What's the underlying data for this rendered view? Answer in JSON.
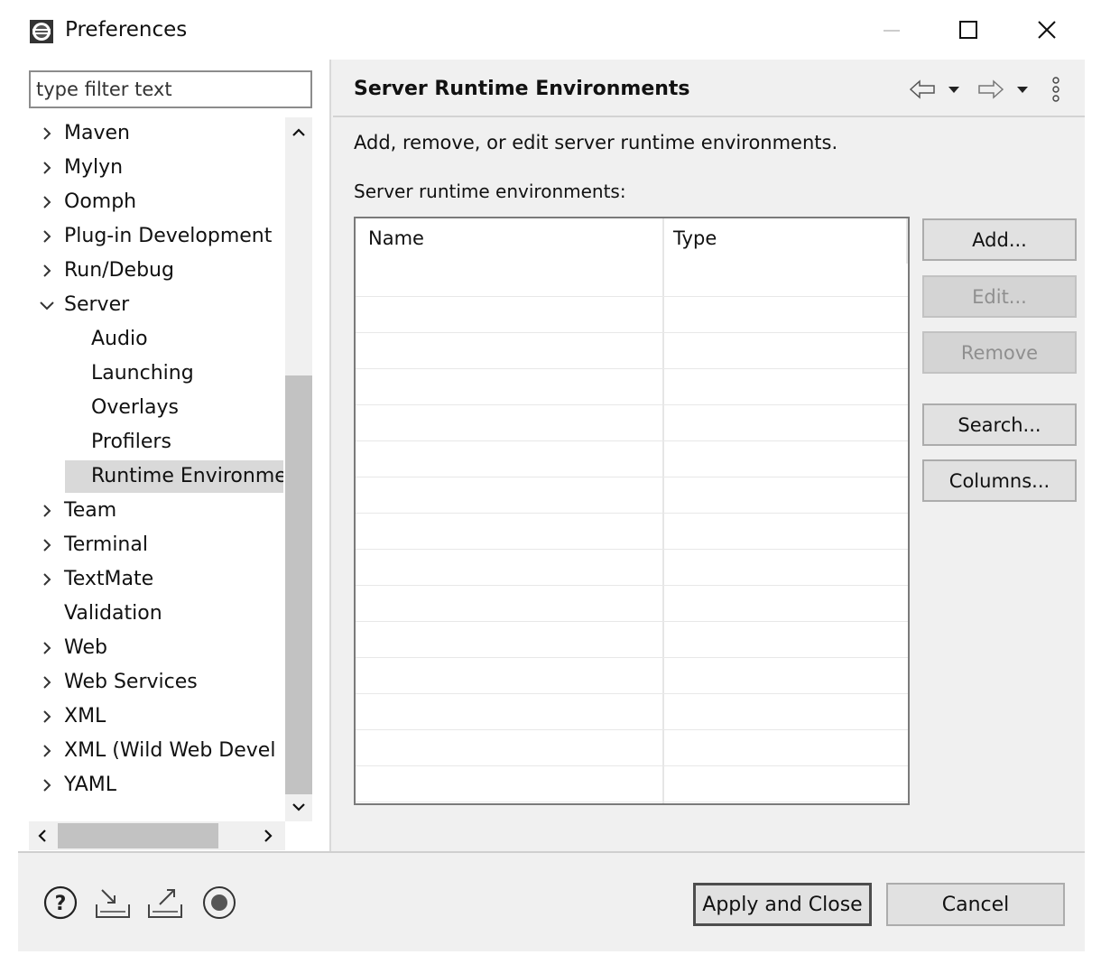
{
  "window": {
    "title": "Preferences",
    "controls": {
      "minimize": "minimize-icon",
      "maximize": "maximize-icon",
      "close": "close-icon"
    }
  },
  "filter": {
    "placeholder": "type filter text",
    "value": ""
  },
  "tree": {
    "items": [
      {
        "label": "Maven",
        "level": 0,
        "expander": "collapsed"
      },
      {
        "label": "Mylyn",
        "level": 0,
        "expander": "collapsed"
      },
      {
        "label": "Oomph",
        "level": 0,
        "expander": "collapsed"
      },
      {
        "label": "Plug-in Development",
        "level": 0,
        "expander": "collapsed"
      },
      {
        "label": "Run/Debug",
        "level": 0,
        "expander": "collapsed"
      },
      {
        "label": "Server",
        "level": 0,
        "expander": "expanded"
      },
      {
        "label": "Audio",
        "level": 1,
        "expander": "none"
      },
      {
        "label": "Launching",
        "level": 1,
        "expander": "none"
      },
      {
        "label": "Overlays",
        "level": 1,
        "expander": "none"
      },
      {
        "label": "Profilers",
        "level": 1,
        "expander": "none"
      },
      {
        "label": "Runtime Environme",
        "level": 1,
        "expander": "none",
        "selected": true
      },
      {
        "label": "Team",
        "level": 0,
        "expander": "collapsed"
      },
      {
        "label": "Terminal",
        "level": 0,
        "expander": "collapsed"
      },
      {
        "label": "TextMate",
        "level": 0,
        "expander": "collapsed"
      },
      {
        "label": "Validation",
        "level": 0,
        "expander": "none"
      },
      {
        "label": "Web",
        "level": 0,
        "expander": "collapsed"
      },
      {
        "label": "Web Services",
        "level": 0,
        "expander": "collapsed"
      },
      {
        "label": "XML",
        "level": 0,
        "expander": "collapsed"
      },
      {
        "label": "XML (Wild Web Devel",
        "level": 0,
        "expander": "collapsed"
      },
      {
        "label": "YAML",
        "level": 0,
        "expander": "collapsed"
      }
    ]
  },
  "page": {
    "title": "Server Runtime Environments",
    "description": "Add, remove, or edit server runtime environments.",
    "table_label": "Server runtime environments:",
    "columns": [
      "Name",
      "Type"
    ],
    "rows": []
  },
  "side_buttons": {
    "add": "Add...",
    "edit": "Edit...",
    "remove": "Remove",
    "search": "Search...",
    "columns": "Columns..."
  },
  "footer": {
    "apply_close": "Apply and Close",
    "cancel": "Cancel",
    "icons": [
      "help-icon",
      "import-icon",
      "export-icon",
      "record-icon"
    ]
  },
  "colors": {
    "frame": "#f0f0f0",
    "selection": "#d9d9d9",
    "button": "#e1e1e1"
  }
}
